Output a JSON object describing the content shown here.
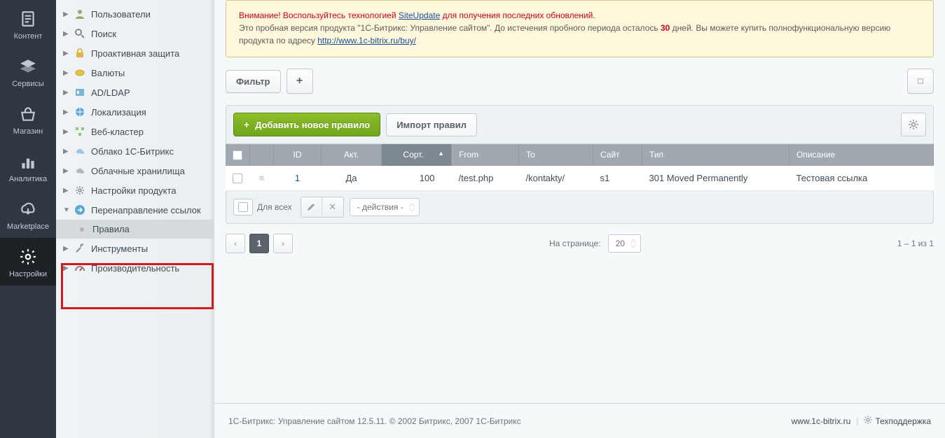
{
  "leftrail": [
    {
      "id": "content",
      "label": "Контент"
    },
    {
      "id": "services",
      "label": "Сервисы"
    },
    {
      "id": "shop",
      "label": "Магазин"
    },
    {
      "id": "analytics",
      "label": "Аналитика"
    },
    {
      "id": "marketplace",
      "label": "Marketplace"
    },
    {
      "id": "settings",
      "label": "Настройки"
    }
  ],
  "tree": {
    "users": "Пользователи",
    "search": "Поиск",
    "proactive": "Проактивная защита",
    "currency": "Валюты",
    "adldap": "AD/LDAP",
    "localization": "Локализация",
    "webcluster": "Веб-кластер",
    "cloud_bitrix": "Облако 1С-Битрикс",
    "cloud_storage": "Облачные хранилища",
    "product_settings": "Настройки продукта",
    "redirects": "Перенаправление ссылок",
    "rules": "Правила",
    "tools": "Инструменты",
    "performance": "Производительность"
  },
  "alert": {
    "title": "Внимание! Воспользуйтесь технологией ",
    "su_link": "SiteUpdate",
    "tail1": " для получения последних обновлений.",
    "line2_a": "Это пробная версия продукта \"1С-Битрикс: Управление сайтом\". До истечения пробного периода осталось ",
    "days": "30",
    "line2_b": " дней. Вы можете купить полнофункциональную версию продукта по адресу ",
    "buy_url": "http://www.1c-bitrix.ru/buy/"
  },
  "toolbar": {
    "filter": "Фильтр",
    "plus": "+"
  },
  "actions": {
    "add_rule": "Добавить новое правило",
    "import": "Импорт правил"
  },
  "columns": {
    "id": "ID",
    "active": "Акт.",
    "sort": "Сорт.",
    "from": "From",
    "to": "To",
    "site": "Сайт",
    "type": "Тип",
    "description": "Описание"
  },
  "row": {
    "id": "1",
    "active": "Да",
    "sort": "100",
    "from": "/test.php",
    "to": "/kontakty/",
    "site": "s1",
    "type": "301 Moved Permanently",
    "description": "Тестовая ссылка"
  },
  "footer_grid": {
    "for_all": "Для всех",
    "actions_select": "- действия -"
  },
  "pager": {
    "page": "1",
    "per_page_label": "На странице:",
    "per_page_value": "20",
    "range": "1 – 1 из 1"
  },
  "page_footer": {
    "left": "1С-Битрикс: Управление сайтом 12.5.11. © 2002 Битрикс, 2007 1С-Битрикс",
    "site_link": "www.1c-bitrix.ru",
    "support": "Техподдержка"
  }
}
